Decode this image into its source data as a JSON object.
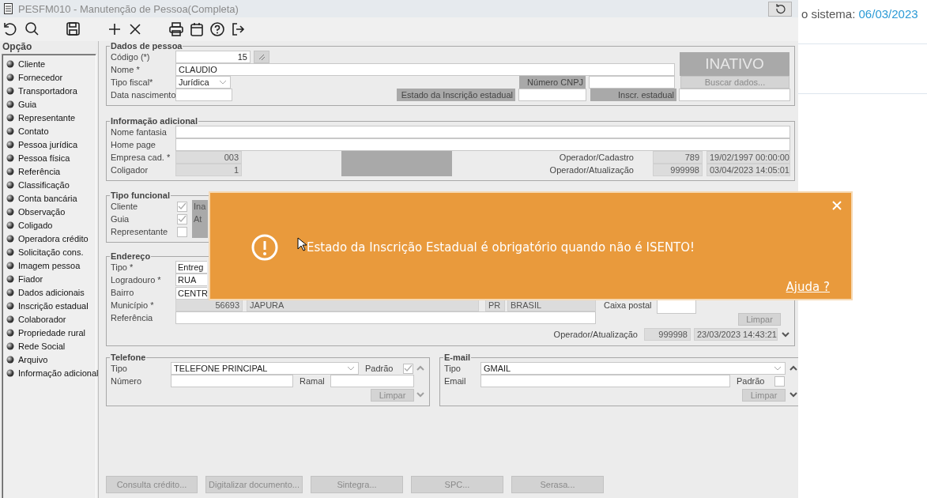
{
  "window": {
    "title": "PESFM010 - Manutenção de Pessoa(Completa)"
  },
  "backdrop": {
    "label": "o sistema:",
    "date": "06/03/2023"
  },
  "sidebar": {
    "title": "Opção",
    "items": [
      "Cliente",
      "Fornecedor",
      "Transportadora",
      "Guia",
      "Representante",
      "Contato",
      "Pessoa jurídica",
      "Pessoa física",
      "Referência",
      "Classificação",
      "Conta bancária",
      "Observação",
      "Coligado",
      "Operadora crédito",
      "Solicitação cons.",
      "Imagem pessoa",
      "Fiador",
      "Dados adicionais",
      "Inscrição estadual",
      "Colaborador",
      "Propriedade rural",
      "Rede Social",
      "Arquivo",
      "Informação adicional"
    ]
  },
  "dados_pessoa": {
    "title": "Dados de pessoa",
    "codigo_label": "Código (*)",
    "codigo": "15",
    "nome_label": "Nome *",
    "nome": "CLAUDIO",
    "tipo_fiscal_label": "Tipo fiscal*",
    "tipo_fiscal": "Jurídica",
    "data_nascimento_label": "Data nascimento",
    "status": "INATIVO",
    "cnpj_label": "Número CNPJ",
    "buscar_button": "Buscar dados...",
    "estado_ie_label": "Estado da Inscrição estadual",
    "inscr_label": "Inscr. estadual"
  },
  "informacao_adicional": {
    "title": "Informação adicional",
    "nome_fantasia_label": "Nome fantasia",
    "home_page_label": "Home page",
    "empresa_label": "Empresa cad. *",
    "empresa": "003",
    "coligador_label": "Coligador",
    "coligador": "1",
    "operador_cadastro_label": "Operador/Cadastro",
    "operador_cadastro": "789",
    "data_cadastro": "19/02/1997 00:00:00",
    "operador_atualizacao_label": "Operador/Atualização",
    "operador_atualizacao": "999998",
    "data_atualizacao": "03/04/2023 14:05:01"
  },
  "tipo_funcional": {
    "title": "Tipo funcional",
    "rows": [
      {
        "label": "Cliente",
        "checked": true,
        "status": "Ina"
      },
      {
        "label": "Guia",
        "checked": true,
        "status": "At"
      },
      {
        "label": "Representante",
        "checked": false
      }
    ]
  },
  "endereco": {
    "title": "Endereço",
    "fields": [
      {
        "label": "Tipo *",
        "value": "Entreg"
      },
      {
        "label": "Logradouro *",
        "value": "RUA"
      },
      {
        "label": "Bairro",
        "value": "CENTR"
      }
    ],
    "municipio_label": "Município *",
    "municipio_codigo": "56693",
    "municipio": "JAPURA",
    "uf": "PR",
    "pais": "BRASIL",
    "referencia_label": "Referência",
    "caixa_postal_label": "Caixa postal",
    "limpar_button": "Limpar",
    "operador_label": "Operador/Atualização",
    "operador": "999998",
    "data_atualizacao": "23/03/2023 14:43:21"
  },
  "telefone": {
    "title": "Telefone",
    "tipo_label": "Tipo",
    "tipo": "TELEFONE PRINCIPAL",
    "padrao_label": "Padrão",
    "padrao": true,
    "numero_label": "Número",
    "ramal_label": "Ramal",
    "limpar_button": "Limpar"
  },
  "email": {
    "title": "E-mail",
    "tipo_label": "Tipo",
    "tipo": "GMAIL",
    "email_label": "Email",
    "padrao_label": "Padrão",
    "padrao": false,
    "limpar_button": "Limpar"
  },
  "buttons": [
    "Consulta crédito...",
    "Digitalizar documento...",
    "Sintegra...",
    "SPC...",
    "Serasa..."
  ],
  "alert": {
    "message": "Estado da Inscrição Estadual é obrigatório quando não é ISENTO!",
    "link": "Ajuda ?"
  }
}
